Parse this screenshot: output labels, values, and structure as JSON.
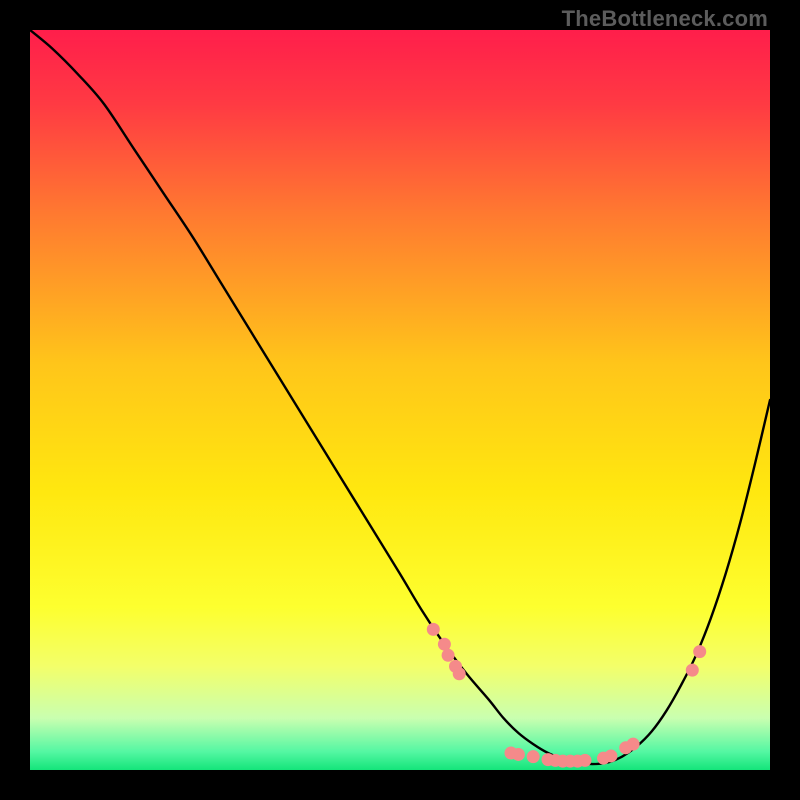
{
  "watermark": "TheBottleneck.com",
  "chart_data": {
    "type": "line",
    "title": "",
    "xlabel": "",
    "ylabel": "",
    "xlim": [
      0,
      100
    ],
    "ylim": [
      0,
      100
    ],
    "grid": false,
    "legend": false,
    "background_gradient": {
      "stops": [
        {
          "pos": 0.0,
          "color": "#ff1e4b"
        },
        {
          "pos": 0.1,
          "color": "#ff3a43"
        },
        {
          "pos": 0.25,
          "color": "#ff7a30"
        },
        {
          "pos": 0.45,
          "color": "#ffc51a"
        },
        {
          "pos": 0.62,
          "color": "#ffe70f"
        },
        {
          "pos": 0.78,
          "color": "#fdff2f"
        },
        {
          "pos": 0.86,
          "color": "#f3ff6a"
        },
        {
          "pos": 0.93,
          "color": "#c9ffb0"
        },
        {
          "pos": 0.975,
          "color": "#55f7a3"
        },
        {
          "pos": 1.0,
          "color": "#14e57a"
        }
      ]
    },
    "series": [
      {
        "name": "bottleneck-curve",
        "type": "line",
        "color": "#000000",
        "stroke_width": 2.4,
        "x": [
          0,
          3,
          6.5,
          10,
          14,
          18,
          22,
          26,
          30,
          34,
          38,
          42,
          46,
          50,
          53,
          56,
          59,
          62,
          64,
          66,
          68,
          70,
          72,
          74,
          76,
          78,
          80,
          82,
          84,
          86,
          88,
          90,
          92,
          94,
          96,
          98,
          100
        ],
        "y": [
          100,
          97.5,
          94,
          90,
          84,
          78,
          72,
          65.5,
          59,
          52.5,
          46,
          39.5,
          33,
          26.5,
          21.5,
          17,
          13,
          9.5,
          7,
          5,
          3.5,
          2.3,
          1.5,
          1.0,
          0.8,
          1.0,
          1.8,
          3.2,
          5.2,
          8.0,
          11.5,
          15.5,
          20.5,
          26.5,
          33.5,
          41.5,
          50
        ]
      },
      {
        "name": "sample-markers",
        "type": "scatter",
        "color": "#f58a8a",
        "marker_radius": 6.5,
        "points": [
          {
            "x": 54.5,
            "y": 19.0
          },
          {
            "x": 56.0,
            "y": 17.0
          },
          {
            "x": 56.5,
            "y": 15.5
          },
          {
            "x": 57.5,
            "y": 14.0
          },
          {
            "x": 58.0,
            "y": 13.0
          },
          {
            "x": 65.0,
            "y": 2.3
          },
          {
            "x": 66.0,
            "y": 2.1
          },
          {
            "x": 68.0,
            "y": 1.8
          },
          {
            "x": 70.0,
            "y": 1.4
          },
          {
            "x": 71.0,
            "y": 1.3
          },
          {
            "x": 72.0,
            "y": 1.2
          },
          {
            "x": 73.0,
            "y": 1.2
          },
          {
            "x": 74.0,
            "y": 1.2
          },
          {
            "x": 75.0,
            "y": 1.3
          },
          {
            "x": 77.5,
            "y": 1.6
          },
          {
            "x": 78.5,
            "y": 1.9
          },
          {
            "x": 80.5,
            "y": 3.0
          },
          {
            "x": 81.5,
            "y": 3.5
          },
          {
            "x": 89.5,
            "y": 13.5
          },
          {
            "x": 90.5,
            "y": 16.0
          }
        ]
      }
    ]
  }
}
